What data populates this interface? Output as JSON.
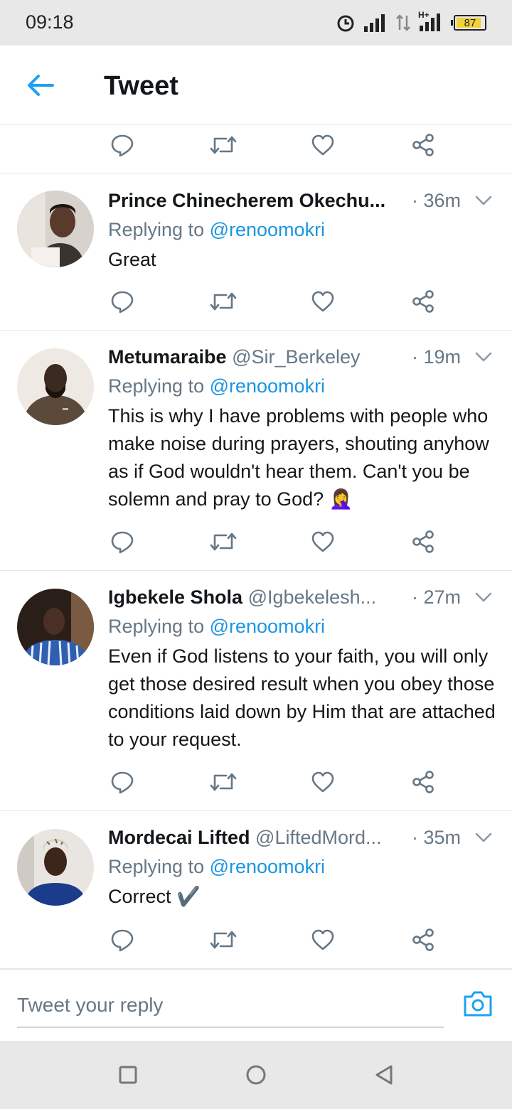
{
  "status_bar": {
    "time": "09:18",
    "battery": "87",
    "network_label": "H+",
    "icons": [
      "alarm-icon",
      "signal-icon",
      "data-arrows-icon",
      "signal-icon",
      "battery-icon"
    ]
  },
  "header": {
    "title": "Tweet",
    "back_icon": "arrow-left-icon"
  },
  "colors": {
    "accent": "#1da1f2",
    "mention": "#1b95e0",
    "secondary_text": "#657786",
    "divider": "#e1e8ed",
    "battery_fill": "#f2d23a"
  },
  "tweets": [
    {
      "name": "Prince Chinecherem Okechu...",
      "handle": "",
      "time": "· 36m",
      "replying_prefix": "Replying to ",
      "replying_to": "@renoomokri",
      "body": "Great"
    },
    {
      "name": "Metumaraibe",
      "handle": "@Sir_Berkeley",
      "time": "· 19m",
      "replying_prefix": "Replying to ",
      "replying_to": "@renoomokri",
      "body": "This is why I have problems with people who make noise during prayers, shouting anyhow as if God wouldn't hear them. Can't you be solemn and pray to God? 🤦‍♀️"
    },
    {
      "name": "Igbekele Shola",
      "handle": "@Igbekelesh...",
      "time": "· 27m",
      "replying_prefix": "Replying to ",
      "replying_to": "@renoomokri",
      "body": "Even if God listens to your faith, you will only get those desired result when you obey those conditions laid down by Him that are attached to your request."
    },
    {
      "name": "Mordecai Lifted",
      "handle": "@LiftedMord...",
      "time": "· 35m",
      "replying_prefix": "Replying to ",
      "replying_to": "@renoomokri",
      "body": "Correct ✔️"
    }
  ],
  "reply_box": {
    "placeholder": "Tweet your reply",
    "camera_icon": "camera-icon"
  },
  "nav_bar": {
    "icons": [
      "square-recents-icon",
      "circle-home-icon",
      "triangle-back-icon"
    ]
  }
}
